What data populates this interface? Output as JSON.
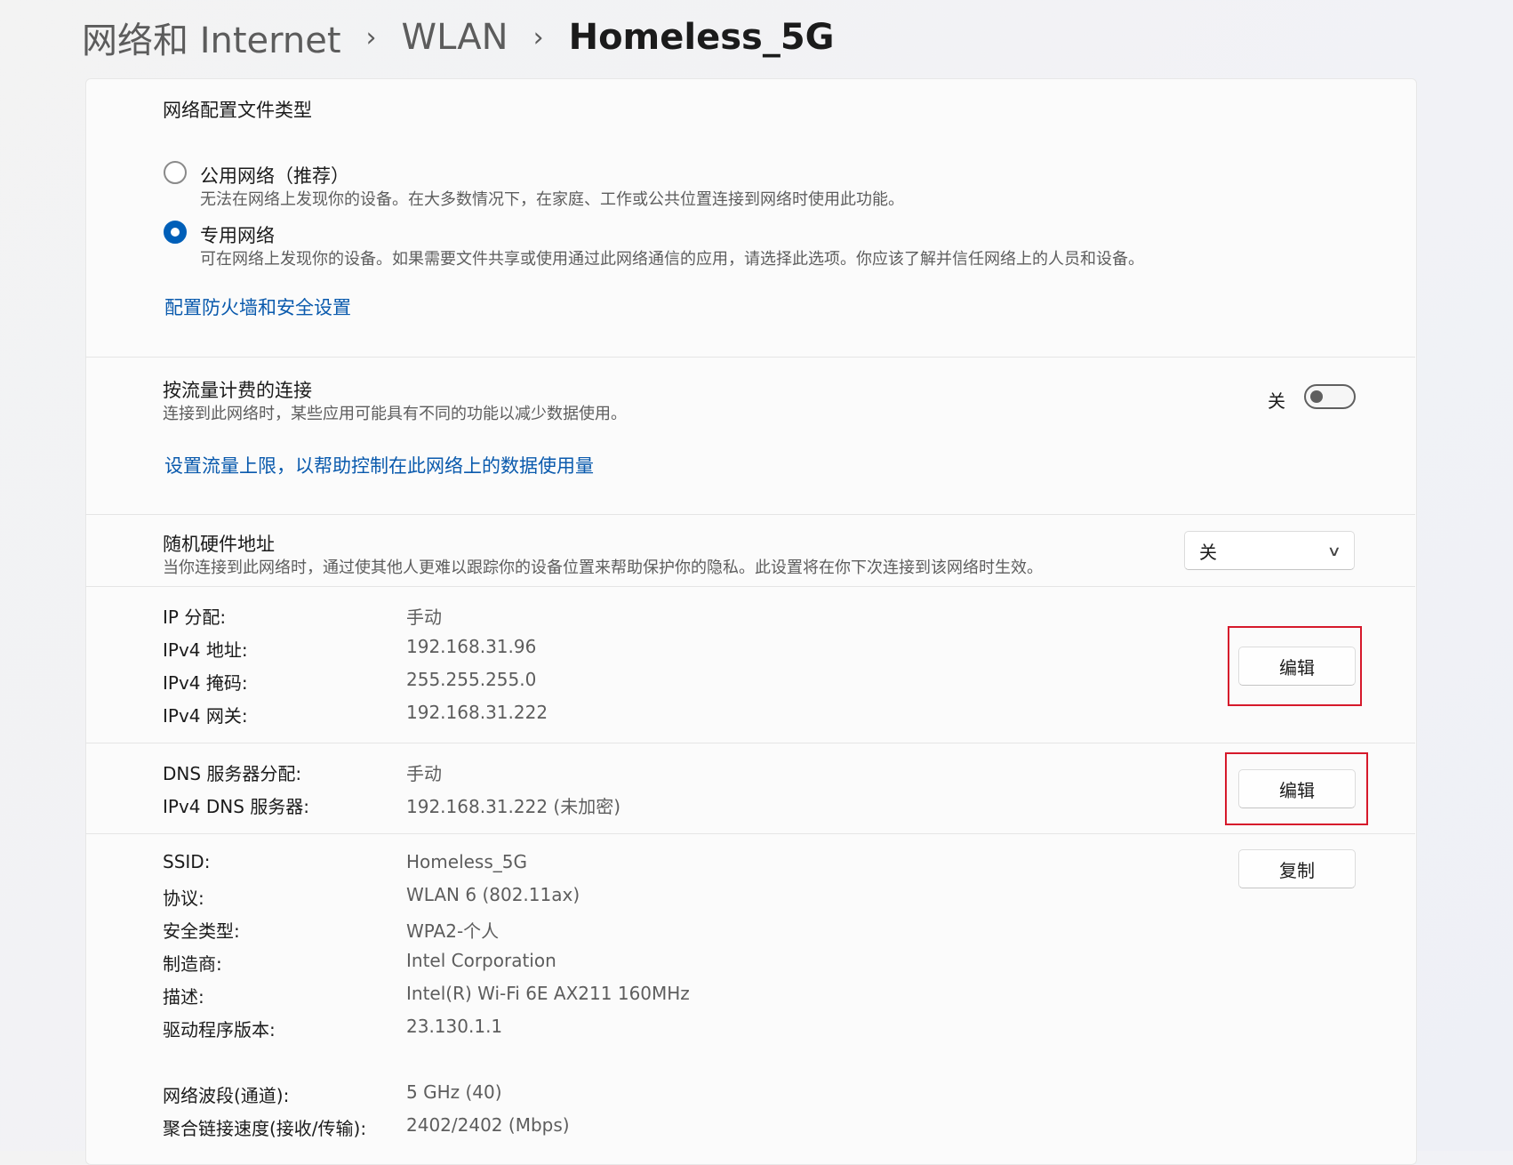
{
  "breadcrumb": {
    "root": "网络和 Internet",
    "middle": "WLAN",
    "current": "Homeless_5G"
  },
  "profile": {
    "title": "网络配置文件类型",
    "options": [
      {
        "label": "公用网络（推荐）",
        "desc": "无法在网络上发现你的设备。在大多数情况下，在家庭、工作或公共位置连接到网络时使用此功能。",
        "selected": false
      },
      {
        "label": "专用网络",
        "desc": "可在网络上发现你的设备。如果需要文件共享或使用通过此网络通信的应用，请选择此选项。你应该了解并信任网络上的人员和设备。",
        "selected": true
      }
    ],
    "firewall_link": "配置防火墙和安全设置"
  },
  "metered": {
    "title": "按流量计费的连接",
    "desc": "连接到此网络时，某些应用可能具有不同的功能以减少数据使用。",
    "state_label": "关",
    "toggle_on": false,
    "data_limit_link": "设置流量上限，以帮助控制在此网络上的数据使用量"
  },
  "random_mac": {
    "title": "随机硬件地址",
    "desc": "当你连接到此网络时，通过使其他人更难以跟踪你的设备位置来帮助保护你的隐私。此设置将在你下次连接到该网络时生效。",
    "selected": "关"
  },
  "ip": {
    "rows": [
      {
        "key": "IP 分配:",
        "value": "手动"
      },
      {
        "key": "IPv4 地址:",
        "value": "192.168.31.96"
      },
      {
        "key": "IPv4 掩码:",
        "value": "255.255.255.0"
      },
      {
        "key": "IPv4 网关:",
        "value": "192.168.31.222"
      }
    ],
    "edit_label": "编辑"
  },
  "dns": {
    "rows": [
      {
        "key": "DNS 服务器分配:",
        "value": "手动"
      },
      {
        "key": "IPv4 DNS 服务器:",
        "value": "192.168.31.222 (未加密)"
      }
    ],
    "edit_label": "编辑"
  },
  "props": {
    "copy_label": "复制",
    "rows": [
      {
        "key": "SSID:",
        "value": "Homeless_5G"
      },
      {
        "key": "协议:",
        "value": "WLAN 6 (802.11ax)"
      },
      {
        "key": "安全类型:",
        "value": "WPA2-个人"
      },
      {
        "key": "制造商:",
        "value": "Intel Corporation"
      },
      {
        "key": "描述:",
        "value": "Intel(R) Wi-Fi 6E AX211 160MHz"
      },
      {
        "key": "驱动程序版本:",
        "value": "23.130.1.1"
      },
      {
        "key": "网络波段(通道):",
        "value": "5 GHz (40)"
      },
      {
        "key": "聚合链接速度(接收/传输):",
        "value": "2402/2402 (Mbps)"
      }
    ]
  },
  "colors": {
    "accent": "#005fb8",
    "link": "#0a5aad",
    "highlight": "#d6192b"
  }
}
